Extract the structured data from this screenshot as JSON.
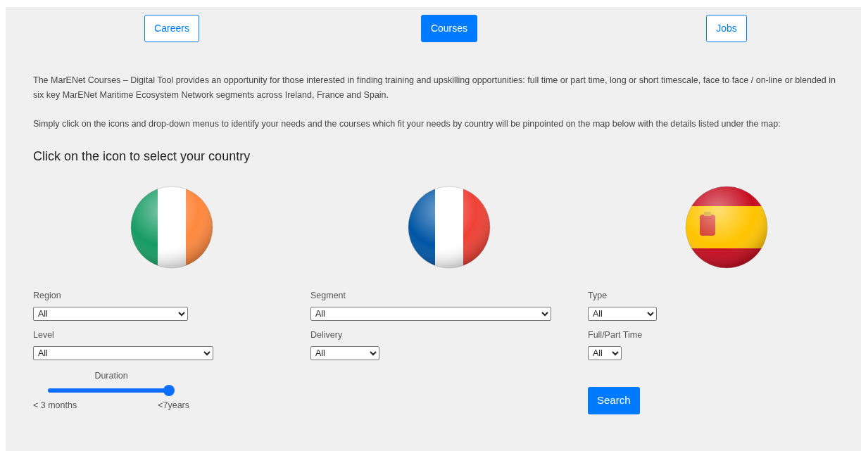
{
  "nav": [
    {
      "label": "Careers",
      "selected": false
    },
    {
      "label": "Courses",
      "selected": true
    },
    {
      "label": "Jobs",
      "selected": false
    }
  ],
  "intro": [
    "The MarENet Courses – Digital Tool provides an opportunity for those interested in finding training and upskilling opportunities: full time or part time, long or short timescale, face to face / on-line or blended in six key MarENet Maritime Ecosystem Network segments across Ireland, France and Spain.",
    "Simply click on the icons and drop-down menus to identify your needs and the courses which fit your needs by country will be pinpointed on the map below with the details listed under the map:"
  ],
  "heading": "Click on the icon to select your country",
  "filters": [
    {
      "label": "Region",
      "value": "All"
    },
    {
      "label": "Segment",
      "value": "All"
    },
    {
      "label": "Type",
      "value": "All"
    },
    {
      "label": "Level",
      "value": "All"
    },
    {
      "label": "Delivery",
      "value": "All"
    },
    {
      "label": "Full/Part Time",
      "value": "All"
    }
  ],
  "duration": {
    "label": "Duration",
    "level": 1.0,
    "min_label": "< 3 months",
    "max_label": "<7years"
  },
  "search_button": "Search"
}
